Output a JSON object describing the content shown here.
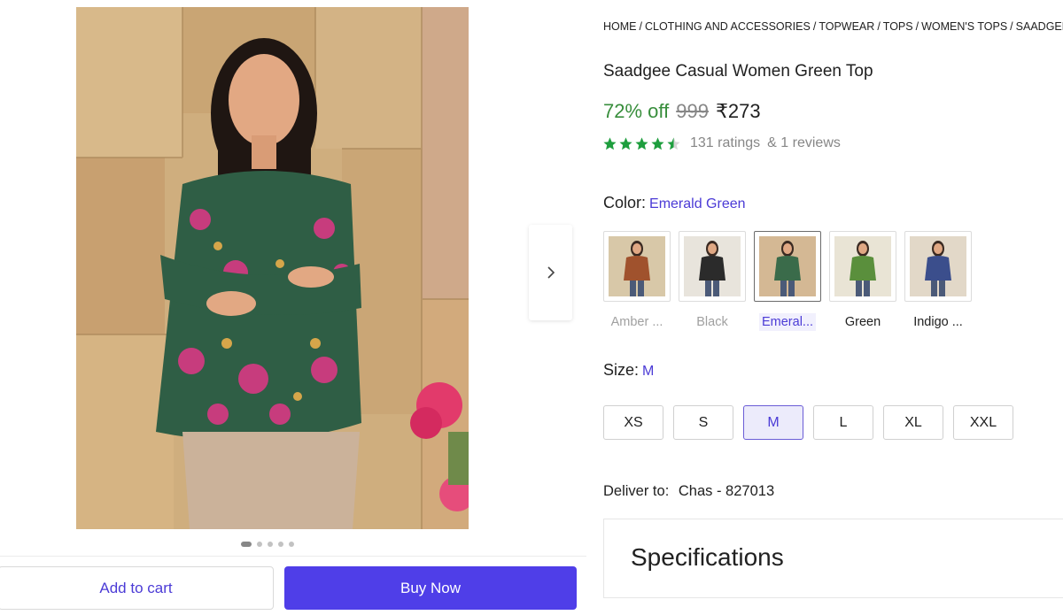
{
  "breadcrumb": [
    "HOME",
    "CLOTHING AND ACCESSORIES",
    "TOPWEAR",
    "TOPS",
    "WOMEN'S TOPS",
    "SAADGEE"
  ],
  "product": {
    "title": "Saadgee Casual Women Green Top",
    "discount": "72% off",
    "mrp": "999",
    "price": "₹273",
    "rating_value": 4.5,
    "ratings_text": "131 ratings",
    "reviews_text": "& 1 reviews"
  },
  "color": {
    "label": "Color:",
    "selected": "Emerald Green",
    "options": [
      {
        "name": "Amber ...",
        "state": "muted",
        "dress": "#a0522d",
        "bg": "#d8c8a8"
      },
      {
        "name": "Black",
        "state": "muted",
        "dress": "#2b2b2b",
        "bg": "#e8e4dc"
      },
      {
        "name": "Emeral...",
        "state": "selected",
        "dress": "#3a6b4a",
        "bg": "#d4b894"
      },
      {
        "name": "Green",
        "state": "normal",
        "dress": "#5a8f3c",
        "bg": "#e9e4d5"
      },
      {
        "name": "Indigo ...",
        "state": "normal",
        "dress": "#3b4e8c",
        "bg": "#e2d8c8"
      }
    ]
  },
  "size": {
    "label": "Size:",
    "selected": "M",
    "options": [
      "XS",
      "S",
      "M",
      "L",
      "XL",
      "XXL"
    ]
  },
  "delivery": {
    "label": "Deliver to:",
    "location": "Chas - 827013"
  },
  "specifications": {
    "title": "Specifications"
  },
  "actions": {
    "add_to_cart": "Add to cart",
    "buy_now": "Buy Now"
  },
  "gallery": {
    "image_count": 5,
    "active_index": 0
  },
  "colors": {
    "accent": "#4f3ee8",
    "discount_green": "#388e3c",
    "star_green": "#1e9e3e"
  }
}
